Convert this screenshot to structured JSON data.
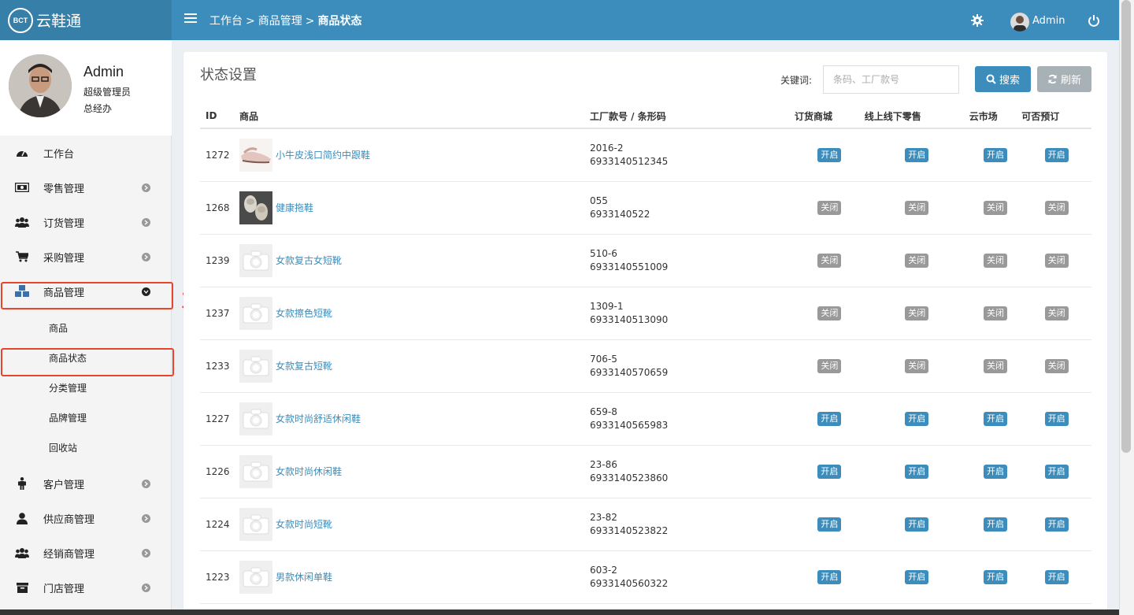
{
  "app": {
    "logo_mark": "BCT",
    "logo_name": "云鞋通"
  },
  "header": {
    "breadcrumb": [
      "工作台",
      "商品管理",
      "商品状态"
    ],
    "breadcrumb_sep": ">",
    "user_name": "Admin",
    "icons": [
      "menu-icon",
      "gear-icon",
      "power-icon"
    ]
  },
  "profile": {
    "name": "Admin",
    "role": "超级管理员",
    "dept": "总经办"
  },
  "sidebar": {
    "items": [
      {
        "label": "工作台",
        "icon": "dashboard-icon"
      },
      {
        "label": "零售管理",
        "icon": "money-icon"
      },
      {
        "label": "订货管理",
        "icon": "users-icon"
      },
      {
        "label": "采购管理",
        "icon": "cart-icon"
      },
      {
        "label": "商品管理",
        "icon": "cubes-icon",
        "expanded": true
      },
      {
        "label": "客户管理",
        "icon": "person-icon"
      },
      {
        "label": "供应商管理",
        "icon": "user-icon"
      },
      {
        "label": "经销商管理",
        "icon": "users-icon"
      },
      {
        "label": "门店管理",
        "icon": "archive-icon"
      }
    ],
    "subitems": [
      {
        "label": "商品"
      },
      {
        "label": "商品状态",
        "active": true
      },
      {
        "label": "分类管理"
      },
      {
        "label": "品牌管理"
      },
      {
        "label": "回收站"
      }
    ]
  },
  "annotations": [
    "1",
    "2"
  ],
  "main": {
    "title": "状态设置",
    "search": {
      "label": "关键词:",
      "placeholder": "条码、工厂款号",
      "value": ""
    },
    "buttons": {
      "search": "搜索",
      "refresh": "刷新"
    },
    "columns": [
      "ID",
      "商品",
      "工厂款号 / 条形码",
      "订货商城",
      "线上线下零售",
      "云市场",
      "可否预订"
    ],
    "flag_labels": {
      "on": "开启",
      "off": "关闭"
    },
    "rows": [
      {
        "id": "1272",
        "name": "小牛皮浅口简约中跟鞋",
        "style": "2016-2",
        "barcode": "6933140512345",
        "thumb": "shoe",
        "flags": [
          "开启",
          "开启",
          "开启",
          "开启"
        ]
      },
      {
        "id": "1268",
        "name": "健康拖鞋",
        "style": "055",
        "barcode": "6933140522",
        "thumb": "slipper",
        "flags": [
          "关闭",
          "关闭",
          "关闭",
          "关闭"
        ]
      },
      {
        "id": "1239",
        "name": "女款复古女短靴",
        "style": "510-6",
        "barcode": "6933140551009",
        "thumb": "none",
        "flags": [
          "关闭",
          "关闭",
          "关闭",
          "关闭"
        ]
      },
      {
        "id": "1237",
        "name": "女款擦色短靴",
        "style": "1309-1",
        "barcode": "6933140513090",
        "thumb": "none",
        "flags": [
          "关闭",
          "关闭",
          "关闭",
          "关闭"
        ]
      },
      {
        "id": "1233",
        "name": "女款复古短靴",
        "style": "706-5",
        "barcode": "6933140570659",
        "thumb": "none",
        "flags": [
          "关闭",
          "关闭",
          "关闭",
          "关闭"
        ]
      },
      {
        "id": "1227",
        "name": "女款时尚舒适休闲鞋",
        "style": "659-8",
        "barcode": "6933140565983",
        "thumb": "none",
        "flags": [
          "开启",
          "开启",
          "开启",
          "开启"
        ]
      },
      {
        "id": "1226",
        "name": "女款时尚休闲鞋",
        "style": "23-86",
        "barcode": "6933140523860",
        "thumb": "none",
        "flags": [
          "开启",
          "开启",
          "开启",
          "开启"
        ]
      },
      {
        "id": "1224",
        "name": "女款时尚短靴",
        "style": "23-82",
        "barcode": "6933140523822",
        "thumb": "none",
        "flags": [
          "开启",
          "开启",
          "开启",
          "开启"
        ]
      },
      {
        "id": "1223",
        "name": "男款休闲单鞋",
        "style": "603-2",
        "barcode": "6933140560322",
        "thumb": "none",
        "flags": [
          "开启",
          "开启",
          "开启",
          "开启"
        ]
      }
    ]
  },
  "colors": {
    "primary": "#3c8dbc",
    "off": "#999999",
    "annotation": "#e8452f"
  }
}
